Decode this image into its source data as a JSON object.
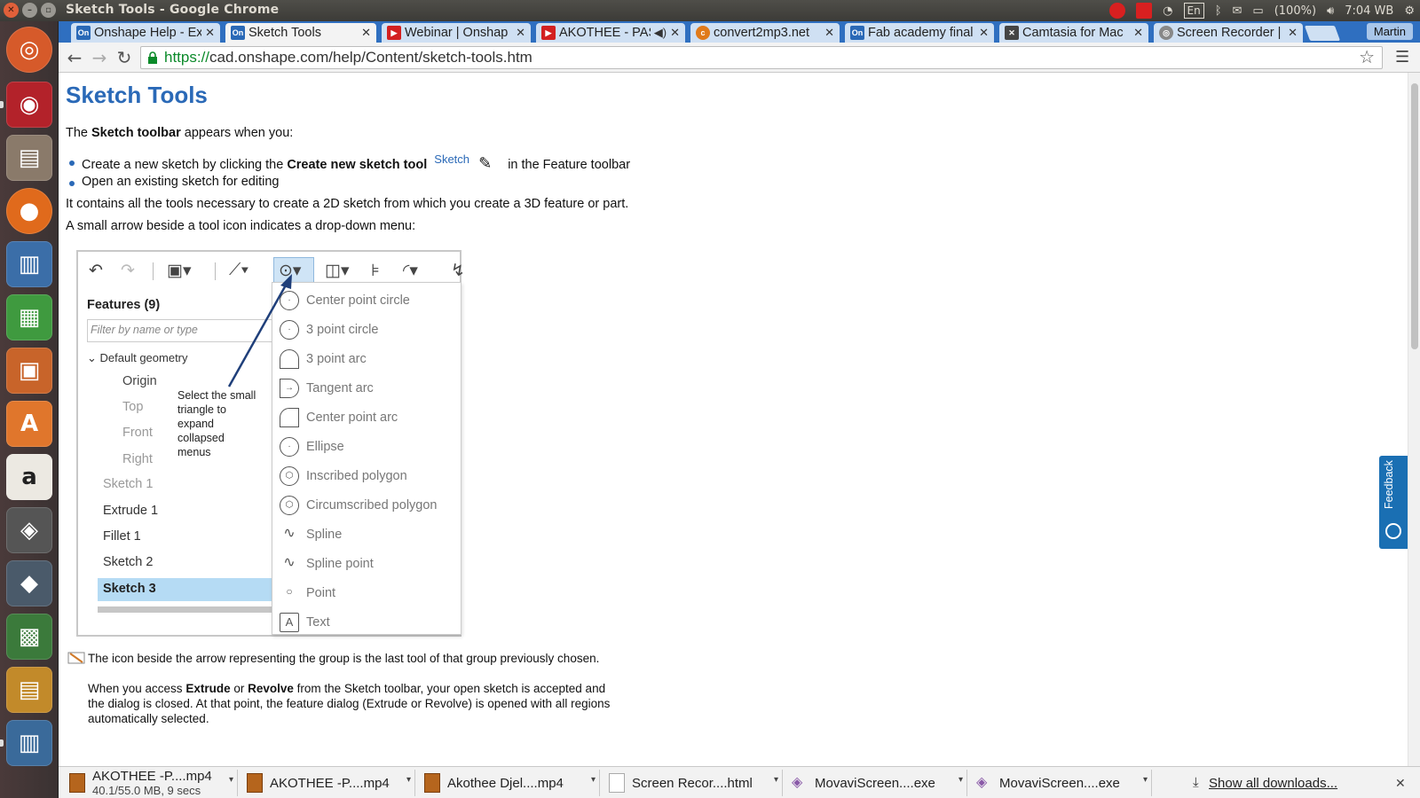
{
  "os": {
    "window_title": "Sketch Tools - Google Chrome",
    "keyboard_layout": "En",
    "battery": "(100%)",
    "clock": "7:04 WB"
  },
  "browser": {
    "tabs": [
      {
        "title": "Onshape Help - Ex",
        "favicon": "onshape-icon",
        "active": false
      },
      {
        "title": "Sketch Tools",
        "favicon": "onshape-icon",
        "active": true
      },
      {
        "title": "Webinar | Onshap",
        "favicon": "youtube-icon",
        "active": false
      },
      {
        "title": "AKOTHEE - PAS",
        "favicon": "youtube-icon",
        "active": false
      },
      {
        "title": "convert2mp3.net",
        "favicon": "convert-icon",
        "active": false
      },
      {
        "title": "Fab academy final",
        "favicon": "onshape-icon",
        "active": false
      },
      {
        "title": "Camtasia for Mac",
        "favicon": "camtasia-icon",
        "active": false
      },
      {
        "title": "Screen Recorder |",
        "favicon": "chrome-icon",
        "active": false
      }
    ],
    "profile_name": "Martin",
    "url_scheme": "https://",
    "url_rest": "cad.onshape.com/help/Content/sketch-tools.htm"
  },
  "page": {
    "title": "Sketch Tools",
    "intro": {
      "pre": "The ",
      "bold": "Sketch toolbar",
      "post": " appears when you:"
    },
    "bullet1": {
      "pre": "Create a new sketch by clicking the ",
      "bold": "Create new sketch tool",
      "link": "Sketch",
      "post": "in the Feature toolbar"
    },
    "bullet2": "Open an existing sketch for editing",
    "para1": "It contains all the tools necessary to create a 2D sketch from which you create a 3D feature or part.",
    "para2": "A small arrow beside a tool icon indicates a drop-down menu:",
    "figure": {
      "features_title": "Features (9)",
      "filter_placeholder": "Filter by name or type",
      "default_geometry": "Default geometry",
      "geometry_items": [
        "Origin",
        "Top",
        "Front",
        "Right"
      ],
      "feature_items": [
        "Sketch 1",
        "Extrude 1",
        "Fillet 1",
        "Sketch 2",
        "Sketch 3"
      ],
      "callout": "Select the small triangle to expand collapsed menus",
      "dropdown_items": [
        {
          "label": "Center point circle",
          "icon": "center-circle-icon"
        },
        {
          "label": "3 point circle",
          "icon": "three-point-circle-icon"
        },
        {
          "label": "3 point arc",
          "icon": "three-point-arc-icon"
        },
        {
          "label": "Tangent arc",
          "icon": "tangent-arc-icon"
        },
        {
          "label": "Center point arc",
          "icon": "center-arc-icon"
        },
        {
          "label": "Ellipse",
          "icon": "ellipse-icon"
        },
        {
          "label": "Inscribed polygon",
          "icon": "inscribed-polygon-icon"
        },
        {
          "label": "Circumscribed polygon",
          "icon": "circumscribed-polygon-icon"
        },
        {
          "label": "Spline",
          "icon": "spline-icon"
        },
        {
          "label": "Spline point",
          "icon": "spline-point-icon"
        },
        {
          "label": "Point",
          "icon": "point-icon"
        },
        {
          "label": "Text",
          "icon": "text-icon"
        }
      ]
    },
    "note1": "The icon beside the arrow representing the group is the last tool of that group previously chosen.",
    "note2": {
      "pre": "When you access ",
      "b1": "Extrude",
      "mid": " or ",
      "b2": "Revolve",
      "post": " from the Sketch toolbar, your open sketch is accepted and the dialog is closed. At that point, the feature dialog (Extrude or Revolve) is opened with all regions automatically selected."
    },
    "feedback_label": "Feedback"
  },
  "downloads": {
    "items": [
      {
        "name": "AKOTHEE -P....mp4",
        "sub": "40.1/55.0 MB, 9 secs",
        "type": "video"
      },
      {
        "name": "AKOTHEE -P....mp4",
        "sub": "",
        "type": "video"
      },
      {
        "name": "Akothee Djel....mp4",
        "sub": "",
        "type": "video"
      },
      {
        "name": "Screen Recor....html",
        "sub": "",
        "type": "doc"
      },
      {
        "name": "MovaviScreen....exe",
        "sub": "",
        "type": "exe"
      },
      {
        "name": "MovaviScreen....exe",
        "sub": "",
        "type": "exe"
      }
    ],
    "show_all": "Show all downloads..."
  }
}
